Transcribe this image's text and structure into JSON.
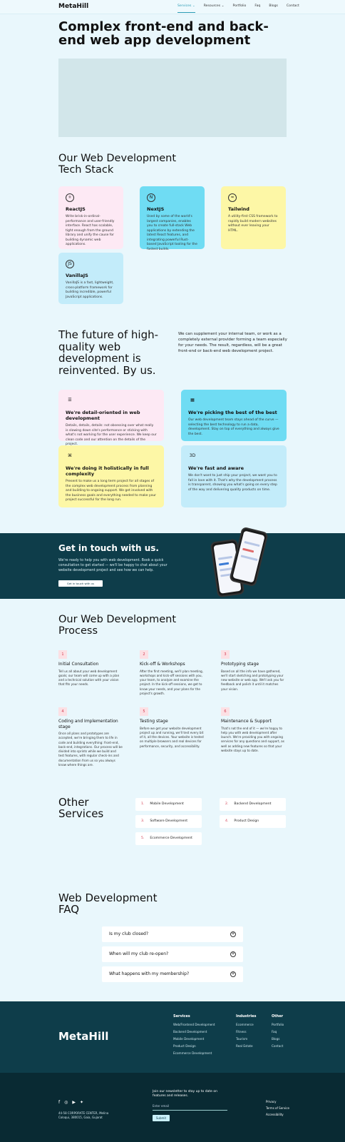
{
  "header": {
    "logo": "MetaHill",
    "nav": [
      "Services ⌄",
      "Resources ⌄",
      "Portfolio",
      "Faq",
      "Blogs",
      "Contact"
    ]
  },
  "hero": {
    "title": "Complex front-end and back-end web app development"
  },
  "stack": {
    "title": "Our Web Development Tech Stack",
    "cards": [
      {
        "icon": "react-icon",
        "glyph": "⚛",
        "title": "ReactJS",
        "desc": "Write brisk-in-ordinal-performance and user-friendly interface. React has scalable, tight enough from the ground library and unify the cause for building dynamic web applications."
      },
      {
        "icon": "next-icon",
        "glyph": "N",
        "title": "NextJS",
        "desc": "Used by some of the world's largest companies, enables you to create full-stack Web applications by extending the latest React features, and integrating powerful Rust-based JavaScript tooling for the fastest builds."
      },
      {
        "icon": "tailwind-icon",
        "glyph": "≈",
        "title": "Tailwind",
        "desc": "A utility-first CSS framework to rapidly build modern websites without ever leaving your HTML."
      },
      {
        "icon": "js-icon",
        "glyph": "JS",
        "title": "VanillaJS",
        "desc": "VanillaJS is a fast, lightweight, cross-platform framework for building incredible, powerful JavaScript applications."
      }
    ]
  },
  "future": {
    "title": "The future of high-quality web development is reinvented. By us.",
    "intro": "We can supplement your internal team, or work as a completely external provider forming a team especially for your needs. The result, regardless, will be a great front-end or back-end web development project.",
    "cards": [
      {
        "icon": "list-icon",
        "glyph": "☰",
        "title": "We're detail-oriented in web development",
        "desc": "Details, details, details: not obsessing over what really is slowing down site's performance or sticking with what's not working for the user experience. We keep our clean code and our attention on the details of the project."
      },
      {
        "icon": "grid-icon",
        "glyph": "▦",
        "title": "We're picking the best of the best",
        "desc": "Our web development team stays ahead of the curve — selecting the best technology to run a data, development. Stay on top of everything and always give the best."
      },
      {
        "icon": "holistic-icon",
        "glyph": "⌘",
        "title": "We're doing it holistically in full complexity",
        "desc": "Present to make us a long term project for all stages of the complex web development process from planning and building to ongoing support. We get involved with the business goals and everything needed to make your project successful for the long run."
      },
      {
        "icon": "speed-icon",
        "glyph": "3D",
        "title": "We're fast and aware",
        "desc": "We don't want to just ship your project, we want you to fall in love with it. That's why the development process is transparent, showing you what's going on every step of the way and delivering quality products on time."
      }
    ]
  },
  "cta": {
    "title": "Get in touch with us.",
    "text": "We're ready to help you with web development. Book a quick consultation to get started — we'll be happy to chat about your website development project and see how we can help.",
    "button": "Get in touch with us"
  },
  "process": {
    "title": "Our Web Development Process",
    "steps": [
      {
        "n": "1",
        "title": "Initial Consultation",
        "desc": "Tell us all about your web development goals; our team will come up with a plan and a technical solution with your vision that fits your needs."
      },
      {
        "n": "2",
        "title": "Kick-off & Workshops",
        "desc": "After the first meeting, we'll plan meeting, workshops and kick-off sessions with you, your team, to analyze and examine the project. In the kick-off sessions, we get to know your needs, and your plans for the project's growth."
      },
      {
        "n": "3",
        "title": "Prototyping stage",
        "desc": "Based on all the info we have gathered, we'll start sketching and prototyping your new website or web app. We'll ask you for feedback and polish it until it matches your vision."
      },
      {
        "n": "4",
        "title": "Coding and Implementation stage",
        "desc": "Once all plans and prototypes are accepted, we're bringing them to life in code and building everything: front-end, back-end, integrations. Our process will be divided into sprints while we build and test features, with regular check-ins and documentation from us so you always know where things are."
      },
      {
        "n": "5",
        "title": "Testing stage",
        "desc": "Before we get your website development project up and running, we'll test every bit of it, all the devices. Your website is tested on multiple browsers and real devices for performance, security, and accessibility."
      },
      {
        "n": "6",
        "title": "Maintenance & Support",
        "desc": "That's not the end of it — we're happy to help you with web development after launch. We're providing you with ongoing services for any questions and support, as well as adding new features so that your website stays up to date."
      }
    ]
  },
  "other": {
    "title": "Other Services",
    "items": [
      {
        "n": "1.",
        "label": "Mobile Development"
      },
      {
        "n": "2.",
        "label": "Backend Development"
      },
      {
        "n": "3.",
        "label": "Software Development"
      },
      {
        "n": "4.",
        "label": "Product Design"
      },
      {
        "n": "5.",
        "label": "Ecommerce Development"
      }
    ]
  },
  "faq": {
    "title": "Web Development FAQ",
    "items": [
      "Is my club closed?",
      "When will my club re-open?",
      "What happens with my membership?"
    ]
  },
  "footer": {
    "logo": "MetaHill",
    "cols": [
      {
        "h": "Services",
        "items": [
          "Web/Frontend Development",
          "Backend Development",
          "Mobile Development",
          "Product Design",
          "Ecommerce Development"
        ]
      },
      {
        "h": "Industries",
        "items": [
          "Ecommerce",
          "Fitness",
          "Tourism",
          "Real Estate"
        ]
      },
      {
        "h": "Other",
        "items": [
          "Portfolio",
          "Faq",
          "Blogs",
          "Contact"
        ]
      }
    ],
    "address": "44-58 CORPORATE CENTER, Melina Coloqui, 380015, Gaia, Gujarat",
    "newsletter_text": "Join our newsletter to stay up to date on features and releases.",
    "email_placeholder": "Enter email",
    "submit": "Submit",
    "legal": [
      "Privacy",
      "Terms of Service",
      "Accessibility"
    ]
  }
}
